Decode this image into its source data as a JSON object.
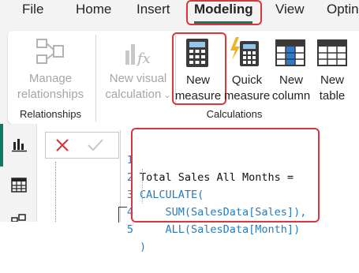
{
  "menu": {
    "file": "File",
    "home": "Home",
    "insert": "Insert",
    "modeling": "Modeling",
    "view": "View",
    "options": "Optin"
  },
  "ribbon": {
    "manage_relationships": {
      "line1": "Manage",
      "line2": "relationships"
    },
    "relationships_group": "Relationships",
    "new_visual_calculation": {
      "line1": "New visual",
      "line2": "calculation"
    },
    "new_measure": {
      "line1": "New",
      "line2": "measure"
    },
    "quick_measure": {
      "line1": "Quick",
      "line2": "measure"
    },
    "new_column": {
      "line1": "New",
      "line2": "column"
    },
    "new_table": {
      "line1": "New",
      "line2": "table"
    },
    "calculations_group": "Calculations"
  },
  "formula": {
    "lines": [
      {
        "num": "1",
        "text": "Total Sales All Months ="
      },
      {
        "num": "2",
        "text": "CALCULATE("
      },
      {
        "num": "3",
        "text": "    SUM(SalesData[Sales]),"
      },
      {
        "num": "4",
        "text": "    ALL(SalesData[Month])"
      },
      {
        "num": "5",
        "text": ")"
      }
    ]
  },
  "colors": {
    "accent": "#117865",
    "highlight_border": "#d9363e",
    "code_keyword": "#2b7bb9"
  }
}
